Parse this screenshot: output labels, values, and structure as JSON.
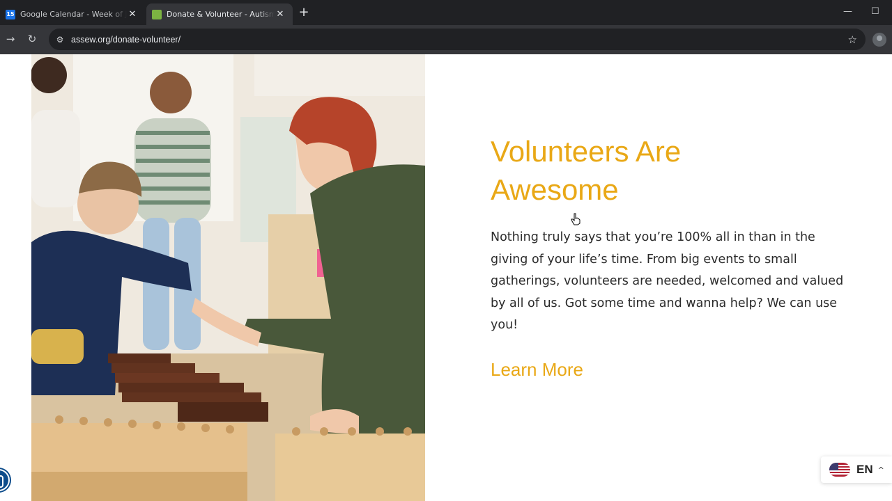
{
  "browser": {
    "tabs": [
      {
        "title": "Google Calendar - Week of Jan...",
        "favicon": "calendar-icon",
        "active": false
      },
      {
        "title": "Donate & Volunteer - Autism S...",
        "favicon": "globe-icon",
        "active": true
      }
    ],
    "favicon_calendar_text": "15",
    "new_tab_symbol": "+",
    "address": "assew.org/donate-volunteer/"
  },
  "section": {
    "heading_line1": "Volunteers Are",
    "heading_line2": "Awesome",
    "body": "Nothing truly says that you’re 100% all in than in the giving of your life’s time. From big events to small gatherings, volunteers are needed, welcomed and valued by all of us. Got some time and wanna help? We can use you!",
    "link_label": "Learn More",
    "accent_color": "#e9a816"
  },
  "language_switcher": {
    "code": "EN",
    "flag": "us-flag-icon"
  }
}
